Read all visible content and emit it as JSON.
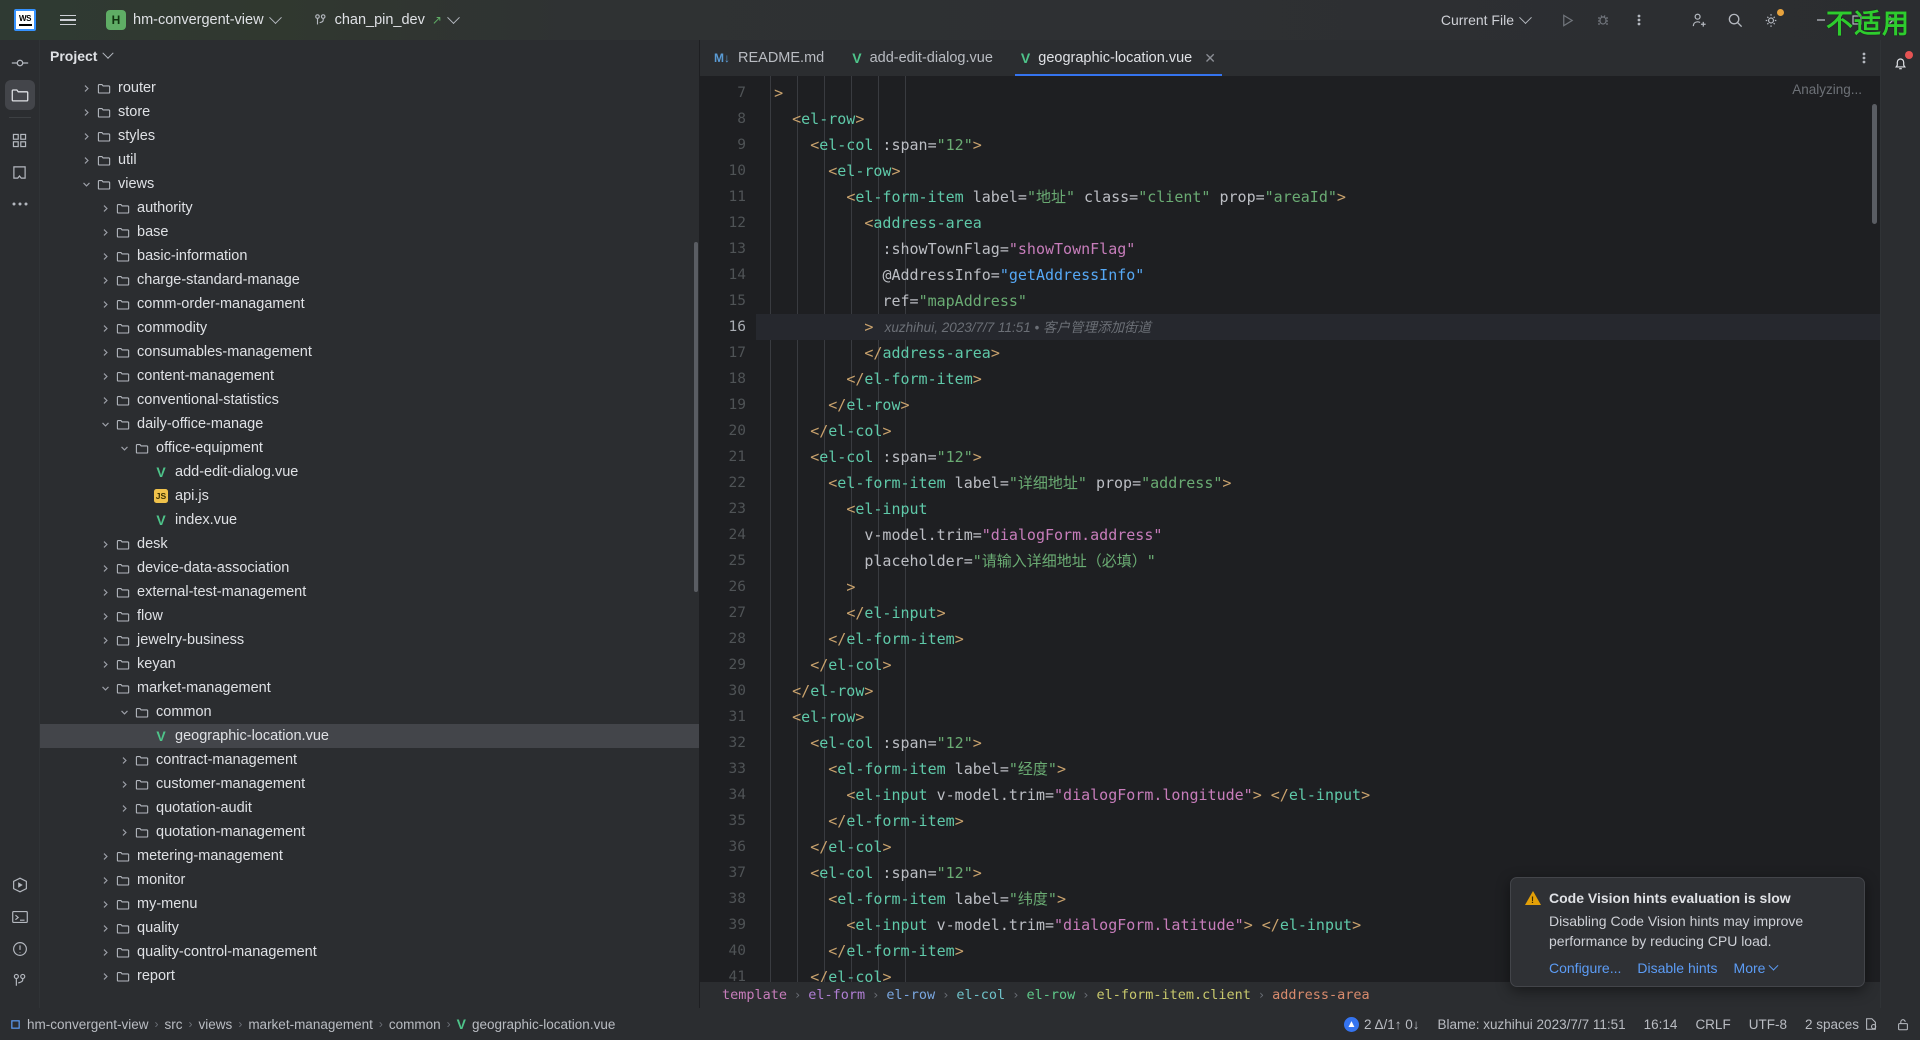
{
  "titlebar": {
    "logo_text": "WS",
    "project_name": "hm-convergent-view",
    "project_badge": "H",
    "branch_name": "chan_pin_dev",
    "run_config": "Current File",
    "overlay_text": "不适用",
    "icons": {
      "hamburger": "hamburger-menu-icon",
      "run": "run-icon",
      "debug": "debug-icon",
      "more": "more-vertical-icon",
      "account": "account-add-icon",
      "search": "search-icon",
      "settings": "settings-gear-icon",
      "minimize": "minimize-icon"
    }
  },
  "rail": {
    "items": [
      {
        "name": "commit-icon"
      },
      {
        "name": "project-folder-icon",
        "active": true
      },
      {
        "name": "structure-icon"
      },
      {
        "name": "bookmarks-icon"
      },
      {
        "name": "more-tools-icon"
      }
    ],
    "bottom_items": [
      {
        "name": "run-panel-icon"
      },
      {
        "name": "terminal-icon"
      },
      {
        "name": "problems-icon"
      },
      {
        "name": "version-control-icon"
      }
    ]
  },
  "project_panel": {
    "title": "Project",
    "tree": [
      {
        "label": "router",
        "indent": 2,
        "type": "folder",
        "state": "collapsed"
      },
      {
        "label": "store",
        "indent": 2,
        "type": "folder",
        "state": "collapsed"
      },
      {
        "label": "styles",
        "indent": 2,
        "type": "folder",
        "state": "collapsed"
      },
      {
        "label": "util",
        "indent": 2,
        "type": "folder",
        "state": "collapsed"
      },
      {
        "label": "views",
        "indent": 2,
        "type": "folder",
        "state": "expanded"
      },
      {
        "label": "authority",
        "indent": 3,
        "type": "folder",
        "state": "collapsed"
      },
      {
        "label": "base",
        "indent": 3,
        "type": "folder",
        "state": "collapsed"
      },
      {
        "label": "basic-information",
        "indent": 3,
        "type": "folder",
        "state": "collapsed"
      },
      {
        "label": "charge-standard-manage",
        "indent": 3,
        "type": "folder",
        "state": "collapsed"
      },
      {
        "label": "comm-order-managament",
        "indent": 3,
        "type": "folder",
        "state": "collapsed"
      },
      {
        "label": "commodity",
        "indent": 3,
        "type": "folder",
        "state": "collapsed"
      },
      {
        "label": "consumables-management",
        "indent": 3,
        "type": "folder",
        "state": "collapsed"
      },
      {
        "label": "content-management",
        "indent": 3,
        "type": "folder",
        "state": "collapsed"
      },
      {
        "label": "conventional-statistics",
        "indent": 3,
        "type": "folder",
        "state": "collapsed"
      },
      {
        "label": "daily-office-manage",
        "indent": 3,
        "type": "folder",
        "state": "expanded"
      },
      {
        "label": "office-equipment",
        "indent": 4,
        "type": "folder",
        "state": "expanded"
      },
      {
        "label": "add-edit-dialog.vue",
        "indent": 5,
        "type": "vue",
        "state": "leaf"
      },
      {
        "label": "api.js",
        "indent": 5,
        "type": "js",
        "state": "leaf"
      },
      {
        "label": "index.vue",
        "indent": 5,
        "type": "vue",
        "state": "leaf"
      },
      {
        "label": "desk",
        "indent": 3,
        "type": "folder",
        "state": "collapsed"
      },
      {
        "label": "device-data-association",
        "indent": 3,
        "type": "folder",
        "state": "collapsed"
      },
      {
        "label": "external-test-management",
        "indent": 3,
        "type": "folder",
        "state": "collapsed"
      },
      {
        "label": "flow",
        "indent": 3,
        "type": "folder",
        "state": "collapsed"
      },
      {
        "label": "jewelry-business",
        "indent": 3,
        "type": "folder",
        "state": "collapsed"
      },
      {
        "label": "keyan",
        "indent": 3,
        "type": "folder",
        "state": "collapsed"
      },
      {
        "label": "market-management",
        "indent": 3,
        "type": "folder",
        "state": "expanded"
      },
      {
        "label": "common",
        "indent": 4,
        "type": "folder",
        "state": "expanded"
      },
      {
        "label": "geographic-location.vue",
        "indent": 5,
        "type": "vue",
        "state": "leaf",
        "selected": true
      },
      {
        "label": "contract-management",
        "indent": 4,
        "type": "folder",
        "state": "collapsed"
      },
      {
        "label": "customer-management",
        "indent": 4,
        "type": "folder",
        "state": "collapsed"
      },
      {
        "label": "quotation-audit",
        "indent": 4,
        "type": "folder",
        "state": "collapsed"
      },
      {
        "label": "quotation-management",
        "indent": 4,
        "type": "folder",
        "state": "collapsed"
      },
      {
        "label": "metering-management",
        "indent": 3,
        "type": "folder",
        "state": "collapsed"
      },
      {
        "label": "monitor",
        "indent": 3,
        "type": "folder",
        "state": "collapsed"
      },
      {
        "label": "my-menu",
        "indent": 3,
        "type": "folder",
        "state": "collapsed"
      },
      {
        "label": "quality",
        "indent": 3,
        "type": "folder",
        "state": "collapsed"
      },
      {
        "label": "quality-control-management",
        "indent": 3,
        "type": "folder",
        "state": "collapsed"
      },
      {
        "label": "report",
        "indent": 3,
        "type": "folder",
        "state": "collapsed"
      }
    ]
  },
  "editor": {
    "tabs": [
      {
        "label": "README.md",
        "icon": "markdown-icon",
        "active": false,
        "closable": false
      },
      {
        "label": "add-edit-dialog.vue",
        "icon": "vue-icon",
        "active": false,
        "closable": false
      },
      {
        "label": "geographic-location.vue",
        "icon": "vue-icon",
        "active": true,
        "closable": true
      }
    ],
    "status_hint": "Analyzing...",
    "first_line_number": 7,
    "current_line": 16,
    "lines": [
      {
        "n": 7,
        "indent": 2,
        "tokens": [
          {
            "c": "p",
            "t": ">"
          }
        ]
      },
      {
        "n": 8,
        "indent": 4,
        "tokens": [
          {
            "c": "p",
            "t": "<"
          },
          {
            "c": "t",
            "t": "el-row"
          },
          {
            "c": "p",
            "t": ">"
          }
        ]
      },
      {
        "n": 9,
        "indent": 6,
        "tokens": [
          {
            "c": "p",
            "t": "<"
          },
          {
            "c": "t",
            "t": "el-col"
          },
          {
            "c": "a",
            "t": " :span="
          },
          {
            "c": "s",
            "t": "\"12\""
          },
          {
            "c": "p",
            "t": ">"
          }
        ]
      },
      {
        "n": 10,
        "indent": 8,
        "tokens": [
          {
            "c": "p",
            "t": "<"
          },
          {
            "c": "t",
            "t": "el-row"
          },
          {
            "c": "p",
            "t": ">"
          }
        ]
      },
      {
        "n": 11,
        "indent": 10,
        "tokens": [
          {
            "c": "p",
            "t": "<"
          },
          {
            "c": "t",
            "t": "el-form-item"
          },
          {
            "c": "a",
            "t": " label="
          },
          {
            "c": "s",
            "t": "\"地址\""
          },
          {
            "c": "a",
            "t": " class="
          },
          {
            "c": "s",
            "t": "\"client\""
          },
          {
            "c": "a",
            "t": " prop="
          },
          {
            "c": "s",
            "t": "\"areaId\""
          },
          {
            "c": "p",
            "t": ">"
          }
        ]
      },
      {
        "n": 12,
        "indent": 12,
        "tokens": [
          {
            "c": "p",
            "t": "<"
          },
          {
            "c": "t",
            "t": "address-area"
          }
        ]
      },
      {
        "n": 13,
        "indent": 14,
        "tokens": [
          {
            "c": "a",
            "t": ":showTownFlag="
          },
          {
            "c": "v",
            "t": "\"showTownFlag\""
          }
        ]
      },
      {
        "n": 14,
        "indent": 14,
        "tokens": [
          {
            "c": "a",
            "t": "@AddressInfo="
          },
          {
            "c": "b",
            "t": "\"getAddressInfo\""
          }
        ]
      },
      {
        "n": 15,
        "indent": 14,
        "tokens": [
          {
            "c": "a",
            "t": "ref="
          },
          {
            "c": "s",
            "t": "\"mapAddress\""
          }
        ]
      },
      {
        "n": 16,
        "indent": 12,
        "tokens": [
          {
            "c": "p",
            "t": ">"
          },
          {
            "c": "blame",
            "t": "   xuzhihui, 2023/7/7 11:51 • 客户管理添加街道"
          }
        ]
      },
      {
        "n": 17,
        "indent": 12,
        "tokens": [
          {
            "c": "p",
            "t": "</"
          },
          {
            "c": "t",
            "t": "address-area"
          },
          {
            "c": "p",
            "t": ">"
          }
        ]
      },
      {
        "n": 18,
        "indent": 10,
        "tokens": [
          {
            "c": "p",
            "t": "</"
          },
          {
            "c": "t",
            "t": "el-form-item"
          },
          {
            "c": "p",
            "t": ">"
          }
        ]
      },
      {
        "n": 19,
        "indent": 8,
        "tokens": [
          {
            "c": "p",
            "t": "</"
          },
          {
            "c": "t",
            "t": "el-row"
          },
          {
            "c": "p",
            "t": ">"
          }
        ]
      },
      {
        "n": 20,
        "indent": 6,
        "tokens": [
          {
            "c": "p",
            "t": "</"
          },
          {
            "c": "t",
            "t": "el-col"
          },
          {
            "c": "p",
            "t": ">"
          }
        ]
      },
      {
        "n": 21,
        "indent": 6,
        "tokens": [
          {
            "c": "p",
            "t": "<"
          },
          {
            "c": "t",
            "t": "el-col"
          },
          {
            "c": "a",
            "t": " :span="
          },
          {
            "c": "s",
            "t": "\"12\""
          },
          {
            "c": "p",
            "t": ">"
          }
        ]
      },
      {
        "n": 22,
        "indent": 8,
        "tokens": [
          {
            "c": "p",
            "t": "<"
          },
          {
            "c": "t",
            "t": "el-form-item"
          },
          {
            "c": "a",
            "t": " label="
          },
          {
            "c": "s",
            "t": "\"详细地址\""
          },
          {
            "c": "a",
            "t": " prop="
          },
          {
            "c": "s",
            "t": "\"address\""
          },
          {
            "c": "p",
            "t": ">"
          }
        ]
      },
      {
        "n": 23,
        "indent": 10,
        "tokens": [
          {
            "c": "p",
            "t": "<"
          },
          {
            "c": "t",
            "t": "el-input"
          }
        ]
      },
      {
        "n": 24,
        "indent": 12,
        "tokens": [
          {
            "c": "a",
            "t": "v-model.trim="
          },
          {
            "c": "v",
            "t": "\"dialogForm.address\""
          }
        ]
      },
      {
        "n": 25,
        "indent": 12,
        "tokens": [
          {
            "c": "a",
            "t": "placeholder="
          },
          {
            "c": "s",
            "t": "\"请输入详细地址（必填）\""
          }
        ]
      },
      {
        "n": 26,
        "indent": 10,
        "tokens": [
          {
            "c": "p",
            "t": ">"
          }
        ]
      },
      {
        "n": 27,
        "indent": 10,
        "tokens": [
          {
            "c": "p",
            "t": "</"
          },
          {
            "c": "t",
            "t": "el-input"
          },
          {
            "c": "p",
            "t": ">"
          }
        ]
      },
      {
        "n": 28,
        "indent": 8,
        "tokens": [
          {
            "c": "p",
            "t": "</"
          },
          {
            "c": "t",
            "t": "el-form-item"
          },
          {
            "c": "p",
            "t": ">"
          }
        ]
      },
      {
        "n": 29,
        "indent": 6,
        "tokens": [
          {
            "c": "p",
            "t": "</"
          },
          {
            "c": "t",
            "t": "el-col"
          },
          {
            "c": "p",
            "t": ">"
          }
        ]
      },
      {
        "n": 30,
        "indent": 4,
        "tokens": [
          {
            "c": "p",
            "t": "</"
          },
          {
            "c": "t",
            "t": "el-row"
          },
          {
            "c": "p",
            "t": ">"
          }
        ]
      },
      {
        "n": 31,
        "indent": 4,
        "tokens": [
          {
            "c": "p",
            "t": "<"
          },
          {
            "c": "t",
            "t": "el-row"
          },
          {
            "c": "p",
            "t": ">"
          }
        ]
      },
      {
        "n": 32,
        "indent": 6,
        "tokens": [
          {
            "c": "p",
            "t": "<"
          },
          {
            "c": "t",
            "t": "el-col"
          },
          {
            "c": "a",
            "t": " :span="
          },
          {
            "c": "s",
            "t": "\"12\""
          },
          {
            "c": "p",
            "t": ">"
          }
        ]
      },
      {
        "n": 33,
        "indent": 8,
        "tokens": [
          {
            "c": "p",
            "t": "<"
          },
          {
            "c": "t",
            "t": "el-form-item"
          },
          {
            "c": "a",
            "t": " label="
          },
          {
            "c": "s",
            "t": "\"经度\""
          },
          {
            "c": "p",
            "t": ">"
          }
        ]
      },
      {
        "n": 34,
        "indent": 10,
        "tokens": [
          {
            "c": "p",
            "t": "<"
          },
          {
            "c": "t",
            "t": "el-input"
          },
          {
            "c": "a",
            "t": " v-model.trim="
          },
          {
            "c": "v",
            "t": "\"dialogForm.longitude\""
          },
          {
            "c": "p",
            "t": "> </"
          },
          {
            "c": "t",
            "t": "el-input"
          },
          {
            "c": "p",
            "t": ">"
          }
        ]
      },
      {
        "n": 35,
        "indent": 8,
        "tokens": [
          {
            "c": "p",
            "t": "</"
          },
          {
            "c": "t",
            "t": "el-form-item"
          },
          {
            "c": "p",
            "t": ">"
          }
        ]
      },
      {
        "n": 36,
        "indent": 6,
        "tokens": [
          {
            "c": "p",
            "t": "</"
          },
          {
            "c": "t",
            "t": "el-col"
          },
          {
            "c": "p",
            "t": ">"
          }
        ]
      },
      {
        "n": 37,
        "indent": 6,
        "tokens": [
          {
            "c": "p",
            "t": "<"
          },
          {
            "c": "t",
            "t": "el-col"
          },
          {
            "c": "a",
            "t": " :span="
          },
          {
            "c": "s",
            "t": "\"12\""
          },
          {
            "c": "p",
            "t": ">"
          }
        ]
      },
      {
        "n": 38,
        "indent": 8,
        "tokens": [
          {
            "c": "p",
            "t": "<"
          },
          {
            "c": "t",
            "t": "el-form-item"
          },
          {
            "c": "a",
            "t": " label="
          },
          {
            "c": "s",
            "t": "\"纬度\""
          },
          {
            "c": "p",
            "t": ">"
          }
        ]
      },
      {
        "n": 39,
        "indent": 10,
        "tokens": [
          {
            "c": "p",
            "t": "<"
          },
          {
            "c": "t",
            "t": "el-input"
          },
          {
            "c": "a",
            "t": " v-model.trim="
          },
          {
            "c": "v",
            "t": "\"dialogForm.latitude\""
          },
          {
            "c": "p",
            "t": "> </"
          },
          {
            "c": "t",
            "t": "el-input"
          },
          {
            "c": "p",
            "t": ">"
          }
        ]
      },
      {
        "n": 40,
        "indent": 8,
        "tokens": [
          {
            "c": "p",
            "t": "</"
          },
          {
            "c": "t",
            "t": "el-form-item"
          },
          {
            "c": "p",
            "t": ">"
          }
        ]
      },
      {
        "n": 41,
        "indent": 6,
        "tokens": [
          {
            "c": "p",
            "t": "</"
          },
          {
            "c": "t",
            "t": "el-col"
          },
          {
            "c": "p",
            "t": ">"
          }
        ]
      }
    ],
    "breadcrumb": [
      {
        "label": "template",
        "cls": "bc1"
      },
      {
        "label": "el-form",
        "cls": "bc2"
      },
      {
        "label": "el-row",
        "cls": "bc3"
      },
      {
        "label": "el-col",
        "cls": "bc4"
      },
      {
        "label": "el-row",
        "cls": "bc5"
      },
      {
        "label": "el-form-item.client",
        "cls": "bc6"
      },
      {
        "label": "address-area",
        "cls": "bc7"
      }
    ]
  },
  "notification": {
    "title": "Code Vision hints evaluation is slow",
    "body": "Disabling Code Vision hints may improve performance by reducing CPU load.",
    "actions": [
      "Configure...",
      "Disable hints",
      "More"
    ]
  },
  "statusbar": {
    "breadcrumb": [
      "hm-convergent-view",
      "src",
      "views",
      "market-management",
      "common"
    ],
    "file": "geographic-location.vue",
    "problems": "2 Δ/1↑ 0↓",
    "blame": "Blame: xuzhihui 2023/7/7 11:51",
    "caret": "16:14",
    "line_sep": "CRLF",
    "encoding": "UTF-8",
    "indent": "2 spaces",
    "icons": [
      "inspections-icon",
      "read-only-lock-icon"
    ]
  }
}
